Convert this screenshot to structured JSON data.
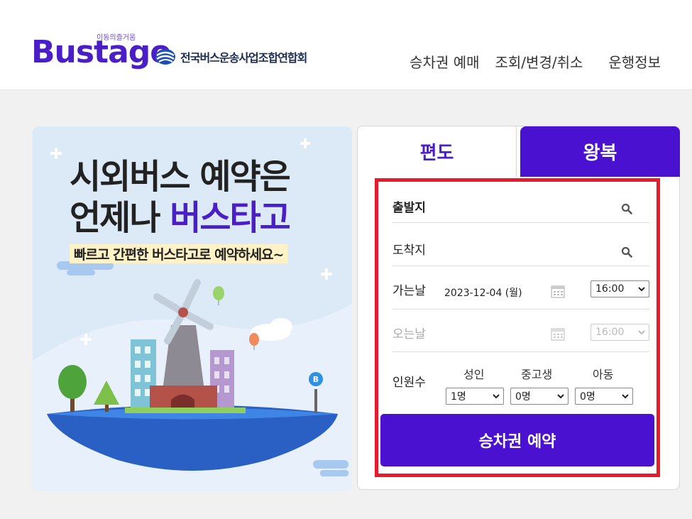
{
  "brand": {
    "logo": "Bustago",
    "tagline": "이동의즐거움",
    "association": "전국버스운송사업조합연합회"
  },
  "nav": [
    "승차권 예매",
    "조회/변경/취소",
    "운행정보"
  ],
  "banner": {
    "line1": "시외버스 예약은",
    "line2_prefix": "언제나 ",
    "line2_accent": "버스타고",
    "subtitle": "빠르고 간편한 버스타고로 예약하세요~",
    "stop_sign": "B"
  },
  "tabs": {
    "oneway": "편도",
    "roundtrip": "왕복"
  },
  "form": {
    "departure_label": "출발지",
    "arrival_label": "도착지",
    "go_date_label": "가는날",
    "go_date_value": "2023-12-04 (월)",
    "go_time": "16:00",
    "return_date_label": "오는날",
    "return_time": "16:00",
    "passengers_label": "인원수",
    "adult_label": "성인",
    "youth_label": "중고생",
    "child_label": "아동",
    "adult_value": "1명",
    "youth_value": "0명",
    "child_value": "0명",
    "submit": "승차권 예약"
  },
  "colors": {
    "brand": "#4a12d0",
    "highlight_border": "#e8192c"
  }
}
